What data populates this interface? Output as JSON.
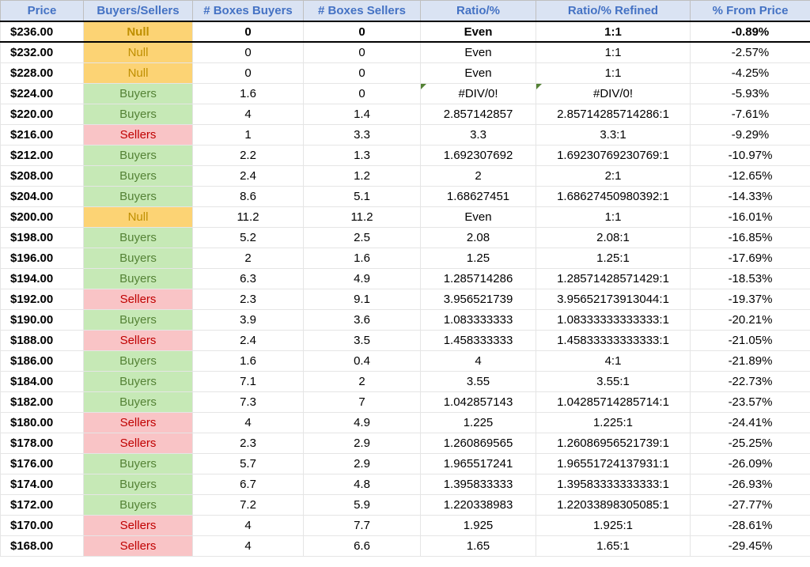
{
  "headers": {
    "price": "Price",
    "buyers_sellers": "Buyers/Sellers",
    "boxes_buyers": "# Boxes Buyers",
    "boxes_sellers": "# Boxes Sellers",
    "ratio": "Ratio/%",
    "ratio_refined": "Ratio/% Refined",
    "pct_from_price": "% From Price"
  },
  "rows": [
    {
      "price": "$236.00",
      "bs": "Null",
      "bs_type": "null",
      "bb": "0",
      "sb": "0",
      "ratio": "Even",
      "refined": "1:1",
      "pct": "-0.89%",
      "highlight": true
    },
    {
      "price": "$232.00",
      "bs": "Null",
      "bs_type": "null",
      "bb": "0",
      "sb": "0",
      "ratio": "Even",
      "refined": "1:1",
      "pct": "-2.57%"
    },
    {
      "price": "$228.00",
      "bs": "Null",
      "bs_type": "null",
      "bb": "0",
      "sb": "0",
      "ratio": "Even",
      "refined": "1:1",
      "pct": "-4.25%"
    },
    {
      "price": "$224.00",
      "bs": "Buyers",
      "bs_type": "buyers",
      "bb": "1.6",
      "sb": "0",
      "ratio": "#DIV/0!",
      "refined": "#DIV/0!",
      "pct": "-5.93%",
      "err": true
    },
    {
      "price": "$220.00",
      "bs": "Buyers",
      "bs_type": "buyers",
      "bb": "4",
      "sb": "1.4",
      "ratio": "2.857142857",
      "refined": "2.85714285714286:1",
      "pct": "-7.61%"
    },
    {
      "price": "$216.00",
      "bs": "Sellers",
      "bs_type": "sellers",
      "bb": "1",
      "sb": "3.3",
      "ratio": "3.3",
      "refined": "3.3:1",
      "pct": "-9.29%"
    },
    {
      "price": "$212.00",
      "bs": "Buyers",
      "bs_type": "buyers",
      "bb": "2.2",
      "sb": "1.3",
      "ratio": "1.692307692",
      "refined": "1.69230769230769:1",
      "pct": "-10.97%"
    },
    {
      "price": "$208.00",
      "bs": "Buyers",
      "bs_type": "buyers",
      "bb": "2.4",
      "sb": "1.2",
      "ratio": "2",
      "refined": "2:1",
      "pct": "-12.65%"
    },
    {
      "price": "$204.00",
      "bs": "Buyers",
      "bs_type": "buyers",
      "bb": "8.6",
      "sb": "5.1",
      "ratio": "1.68627451",
      "refined": "1.68627450980392:1",
      "pct": "-14.33%"
    },
    {
      "price": "$200.00",
      "bs": "Null",
      "bs_type": "null",
      "bb": "11.2",
      "sb": "11.2",
      "ratio": "Even",
      "refined": "1:1",
      "pct": "-16.01%"
    },
    {
      "price": "$198.00",
      "bs": "Buyers",
      "bs_type": "buyers",
      "bb": "5.2",
      "sb": "2.5",
      "ratio": "2.08",
      "refined": "2.08:1",
      "pct": "-16.85%"
    },
    {
      "price": "$196.00",
      "bs": "Buyers",
      "bs_type": "buyers",
      "bb": "2",
      "sb": "1.6",
      "ratio": "1.25",
      "refined": "1.25:1",
      "pct": "-17.69%"
    },
    {
      "price": "$194.00",
      "bs": "Buyers",
      "bs_type": "buyers",
      "bb": "6.3",
      "sb": "4.9",
      "ratio": "1.285714286",
      "refined": "1.28571428571429:1",
      "pct": "-18.53%"
    },
    {
      "price": "$192.00",
      "bs": "Sellers",
      "bs_type": "sellers",
      "bb": "2.3",
      "sb": "9.1",
      "ratio": "3.956521739",
      "refined": "3.95652173913044:1",
      "pct": "-19.37%"
    },
    {
      "price": "$190.00",
      "bs": "Buyers",
      "bs_type": "buyers",
      "bb": "3.9",
      "sb": "3.6",
      "ratio": "1.083333333",
      "refined": "1.08333333333333:1",
      "pct": "-20.21%"
    },
    {
      "price": "$188.00",
      "bs": "Sellers",
      "bs_type": "sellers",
      "bb": "2.4",
      "sb": "3.5",
      "ratio": "1.458333333",
      "refined": "1.45833333333333:1",
      "pct": "-21.05%"
    },
    {
      "price": "$186.00",
      "bs": "Buyers",
      "bs_type": "buyers",
      "bb": "1.6",
      "sb": "0.4",
      "ratio": "4",
      "refined": "4:1",
      "pct": "-21.89%"
    },
    {
      "price": "$184.00",
      "bs": "Buyers",
      "bs_type": "buyers",
      "bb": "7.1",
      "sb": "2",
      "ratio": "3.55",
      "refined": "3.55:1",
      "pct": "-22.73%"
    },
    {
      "price": "$182.00",
      "bs": "Buyers",
      "bs_type": "buyers",
      "bb": "7.3",
      "sb": "7",
      "ratio": "1.042857143",
      "refined": "1.04285714285714:1",
      "pct": "-23.57%"
    },
    {
      "price": "$180.00",
      "bs": "Sellers",
      "bs_type": "sellers",
      "bb": "4",
      "sb": "4.9",
      "ratio": "1.225",
      "refined": "1.225:1",
      "pct": "-24.41%"
    },
    {
      "price": "$178.00",
      "bs": "Sellers",
      "bs_type": "sellers",
      "bb": "2.3",
      "sb": "2.9",
      "ratio": "1.260869565",
      "refined": "1.26086956521739:1",
      "pct": "-25.25%"
    },
    {
      "price": "$176.00",
      "bs": "Buyers",
      "bs_type": "buyers",
      "bb": "5.7",
      "sb": "2.9",
      "ratio": "1.965517241",
      "refined": "1.96551724137931:1",
      "pct": "-26.09%"
    },
    {
      "price": "$174.00",
      "bs": "Buyers",
      "bs_type": "buyers",
      "bb": "6.7",
      "sb": "4.8",
      "ratio": "1.395833333",
      "refined": "1.39583333333333:1",
      "pct": "-26.93%"
    },
    {
      "price": "$172.00",
      "bs": "Buyers",
      "bs_type": "buyers",
      "bb": "7.2",
      "sb": "5.9",
      "ratio": "1.220338983",
      "refined": "1.22033898305085:1",
      "pct": "-27.77%"
    },
    {
      "price": "$170.00",
      "bs": "Sellers",
      "bs_type": "sellers",
      "bb": "4",
      "sb": "7.7",
      "ratio": "1.925",
      "refined": "1.925:1",
      "pct": "-28.61%"
    },
    {
      "price": "$168.00",
      "bs": "Sellers",
      "bs_type": "sellers",
      "bb": "4",
      "sb": "6.6",
      "ratio": "1.65",
      "refined": "1.65:1",
      "pct": "-29.45%"
    }
  ]
}
